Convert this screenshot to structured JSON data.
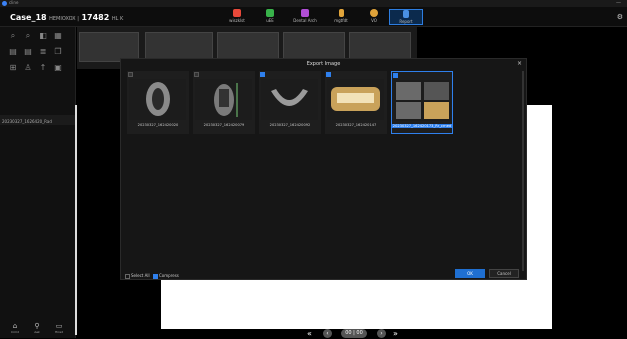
{
  "titlebar": {
    "app_name": "cline",
    "control": "—"
  },
  "header": {
    "case_name": "Case_18",
    "case_small": "HEMIOXOX |",
    "case_id": "17482",
    "case_suffix": "HL K",
    "tools": [
      {
        "label": "wiszklst",
        "color": "#e8493a"
      },
      {
        "label": "uEE",
        "color": "#38b24a"
      },
      {
        "label": "Dental Arch",
        "color": "#b14ed6"
      },
      {
        "label": "mgtfdt",
        "color": "#e2a53b"
      },
      {
        "label": "VO",
        "color": "#e0a33a"
      },
      {
        "label": "Report",
        "color": "#4a90e2"
      }
    ]
  },
  "sidebar": {
    "study_label": "20230327_1626420_Rad",
    "bottom_tools": [
      {
        "label": "Crmd"
      },
      {
        "label": "Aek"
      },
      {
        "label": "Hirad"
      }
    ]
  },
  "modal": {
    "title": "Export Image",
    "close": "×",
    "images": [
      {
        "caption": "20230327_162420020",
        "checked": false
      },
      {
        "caption": "20230327_162420079",
        "checked": false
      },
      {
        "caption": "20230327_162420092",
        "checked": true
      },
      {
        "caption": "20230327_162420147",
        "checked": true
      },
      {
        "caption": "20230327_162420173_Rr_crned",
        "checked": true
      }
    ],
    "select_all": "Select All",
    "compress": "Compress",
    "ok": "OK",
    "cancel": "Cancel"
  },
  "pager": {
    "first": "«",
    "prev": "‹",
    "count": "00 | 00",
    "next": "›",
    "last": "»"
  }
}
